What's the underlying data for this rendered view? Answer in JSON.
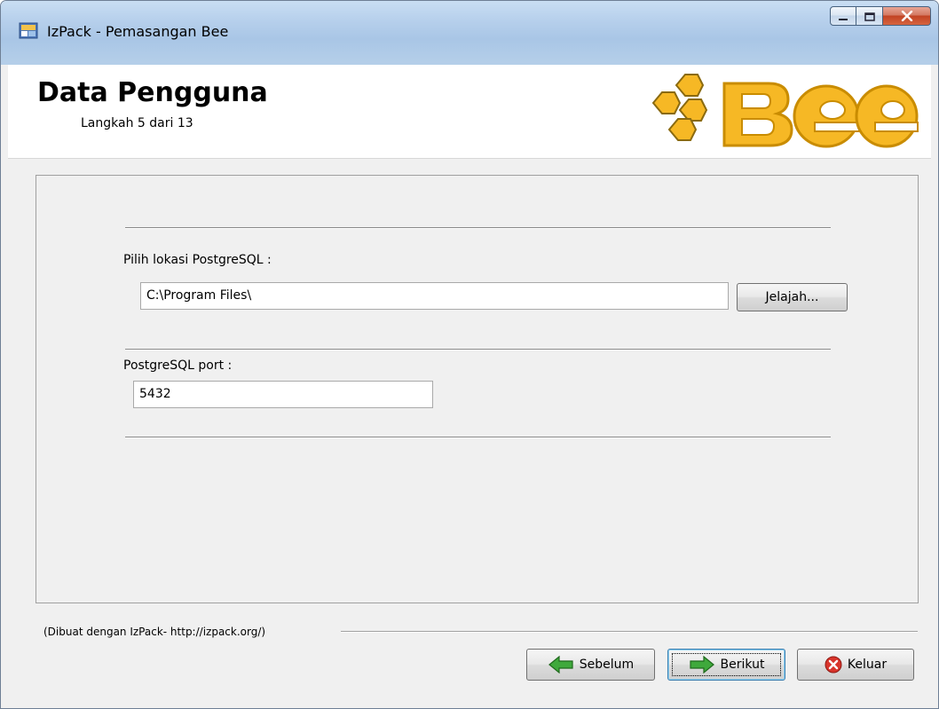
{
  "window": {
    "title": "IzPack - Pemasangan Bee",
    "controls": {
      "minimize": "minimize",
      "maximize": "maximize",
      "close": "close"
    }
  },
  "header": {
    "title": "Data Pengguna",
    "step": "Langkah 5 dari 13",
    "logo_text": "Bee"
  },
  "form": {
    "location_label": "Pilih lokasi PostgreSQL :",
    "location_value": "C:\\Program Files\\",
    "browse_label": "Jelajah...",
    "port_label": "PostgreSQL port :",
    "port_value": "5432"
  },
  "footer": {
    "credit": "(Dibuat dengan IzPack- http://izpack.org/)"
  },
  "buttons": {
    "previous": "Sebelum",
    "next": "Berikut",
    "quit": "Keluar"
  },
  "icons": {
    "app": "izpack-app-icon",
    "previous": "green-arrow-left-icon",
    "next": "green-arrow-right-icon",
    "quit": "red-x-circle-icon"
  },
  "colors": {
    "logo_fill": "#f6b825",
    "logo_stroke": "#c98c00",
    "arrow_green": "#3fa93c",
    "quit_red": "#d8342b"
  }
}
